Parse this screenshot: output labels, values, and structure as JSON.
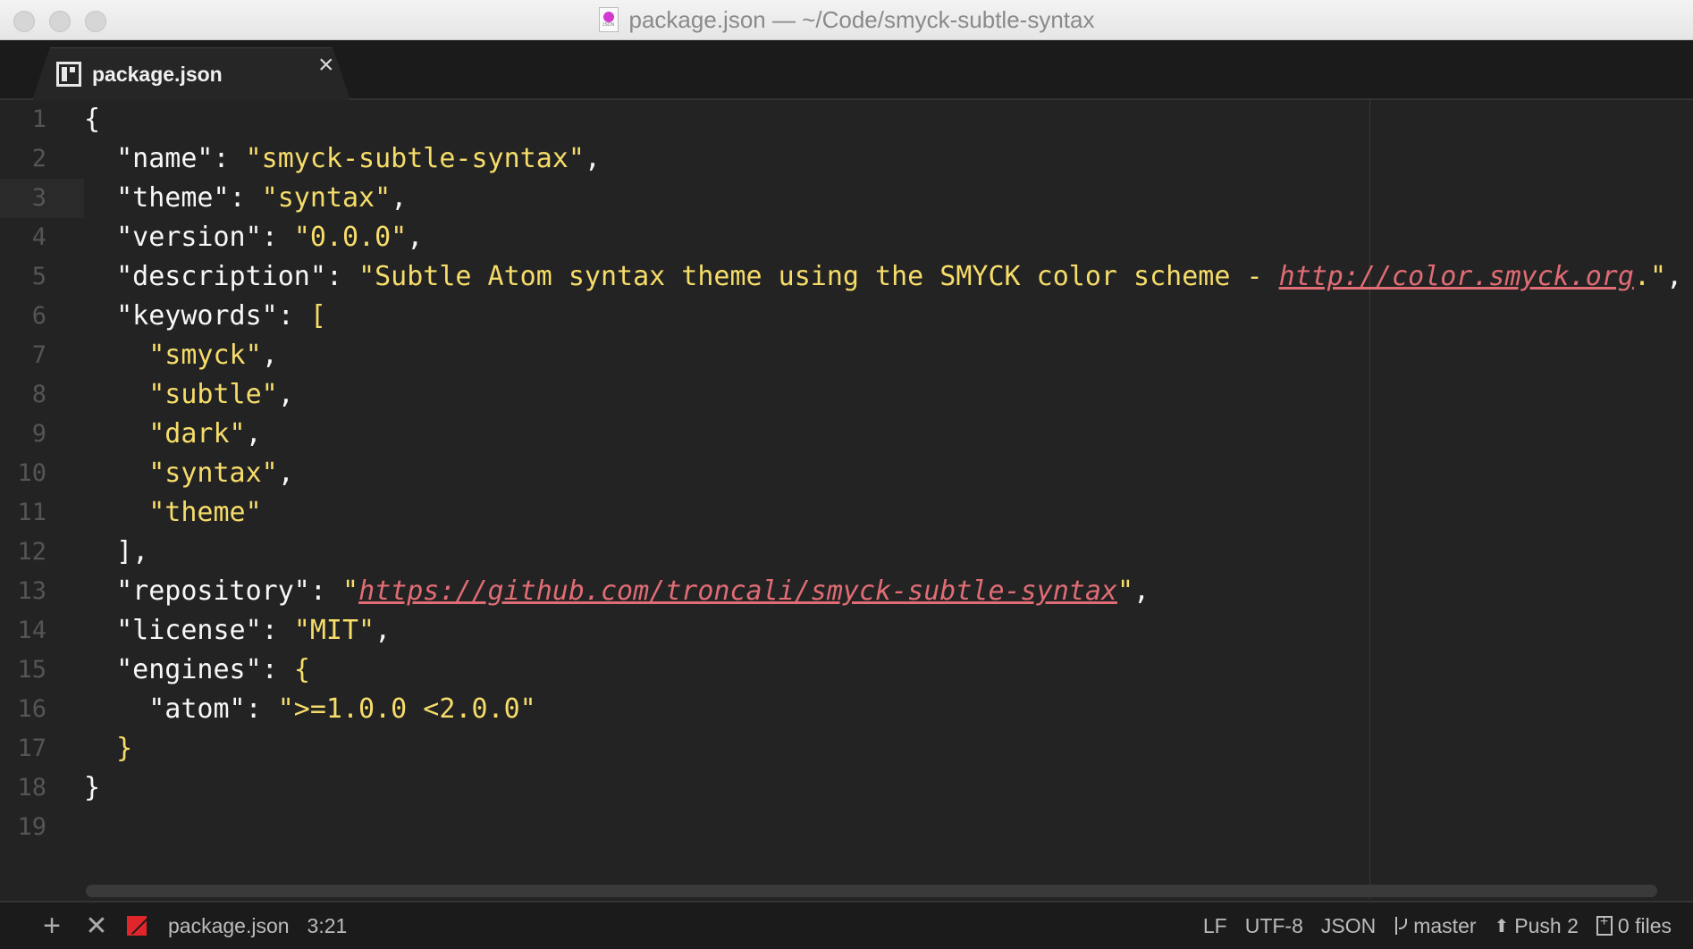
{
  "window": {
    "title": "package.json — ~/Code/smyck-subtle-syntax",
    "file_icon_label": "JSON"
  },
  "tabs": [
    {
      "label": "package.json",
      "close_glyph": "×"
    }
  ],
  "editor": {
    "line_numbers": [
      "1",
      "2",
      "3",
      "4",
      "5",
      "6",
      "7",
      "8",
      "9",
      "10",
      "11",
      "12",
      "13",
      "14",
      "15",
      "16",
      "17",
      "18",
      "19"
    ],
    "lines": [
      {
        "indent": "",
        "key": "",
        "value": "",
        "pre": "{",
        "post": ""
      },
      {
        "indent": "  ",
        "key": "\"name\"",
        "sep": ": ",
        "value": "\"smyck-subtle-syntax\"",
        "post": ","
      },
      {
        "indent": "  ",
        "key": "\"theme\"",
        "sep": ": ",
        "value": "\"syntax\"",
        "post": ","
      },
      {
        "indent": "  ",
        "key": "\"version\"",
        "sep": ": ",
        "value": "\"0.0.0\"",
        "post": ","
      },
      {
        "indent": "  ",
        "key": "\"description\"",
        "sep": ": ",
        "value_pre": "\"Subtle Atom syntax theme using the SMYCK color scheme - ",
        "link": "http://color.smyck.org",
        "value_post": ".\"",
        "post": ","
      },
      {
        "indent": "  ",
        "key": "\"keywords\"",
        "sep": ": ",
        "bracket": "["
      },
      {
        "indent": "    ",
        "value": "\"smyck\"",
        "post": ","
      },
      {
        "indent": "    ",
        "value": "\"subtle\"",
        "post": ","
      },
      {
        "indent": "    ",
        "value": "\"dark\"",
        "post": ","
      },
      {
        "indent": "    ",
        "value": "\"syntax\"",
        "post": ","
      },
      {
        "indent": "    ",
        "value": "\"theme\"",
        "post": ""
      },
      {
        "indent": "  ",
        "pre": "],"
      },
      {
        "indent": "  ",
        "key": "\"repository\"",
        "sep": ": ",
        "value_pre": "\"",
        "link": "https://github.com/troncali/smyck-subtle-syntax",
        "value_post": "\"",
        "post": ","
      },
      {
        "indent": "  ",
        "key": "\"license\"",
        "sep": ": ",
        "value": "\"MIT\"",
        "post": ","
      },
      {
        "indent": "  ",
        "key": "\"engines\"",
        "sep": ": ",
        "bracket": "{"
      },
      {
        "indent": "    ",
        "key": "\"atom\"",
        "sep": ": ",
        "value": "\">=1.0.0 <2.0.0\"",
        "post": ""
      },
      {
        "indent": "  ",
        "bracket_only": "}"
      },
      {
        "indent": "",
        "pre": "}"
      },
      {
        "indent": "",
        "pre": ""
      }
    ]
  },
  "statusbar": {
    "add_glyph": "+",
    "close_glyph": "✕",
    "file": "package.json",
    "cursor": "3:21",
    "line_ending": "LF",
    "encoding": "UTF-8",
    "grammar": "JSON",
    "branch": "master",
    "push": "Push 2",
    "files": "0 files"
  },
  "colors": {
    "string": "#f6dc69",
    "link": "#e06c75",
    "text": "#f7f7f7",
    "line_number": "#555555"
  }
}
